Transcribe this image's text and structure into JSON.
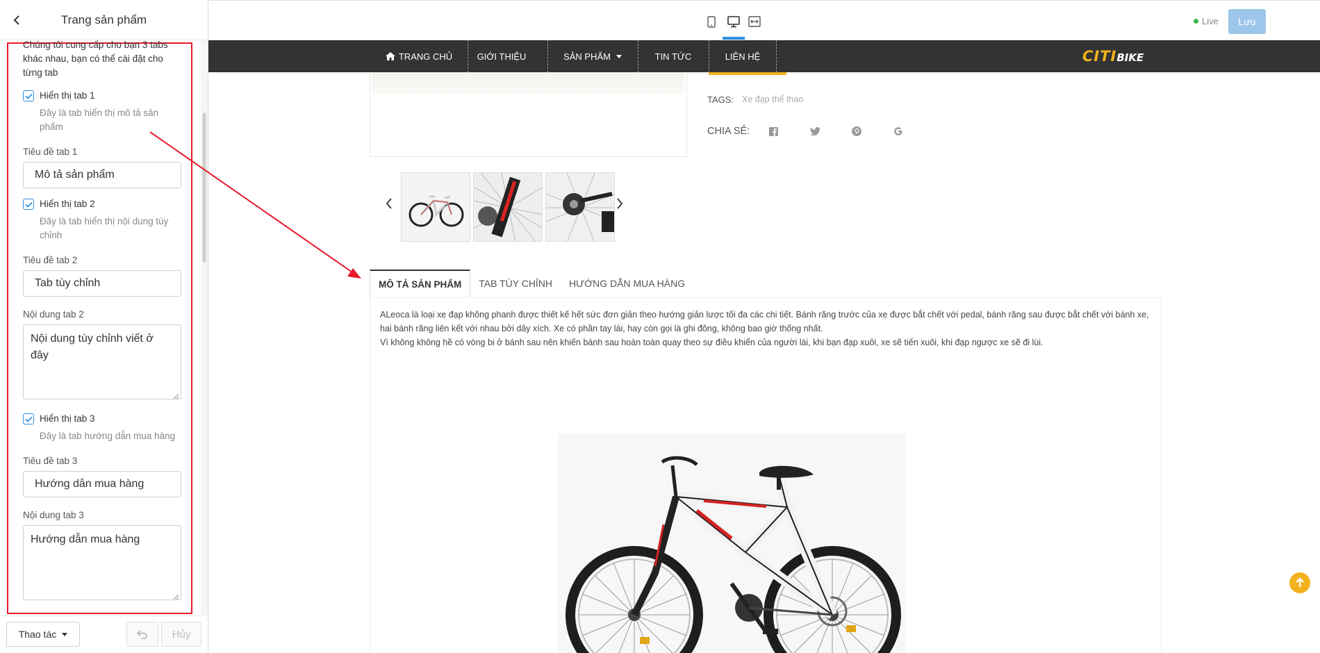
{
  "editor": {
    "panel_title": "Trang sản phẩm",
    "intro_text": "Chúng tôi cung cấp cho bạn 3 tabs khác nhau, bạn có thể cài đặt cho từng tab",
    "tab1": {
      "checkbox_label": "Hiển thị tab 1",
      "checkbox_desc": "Đây là tab hiển thị mô tả sản phẩm",
      "checked": true,
      "title_label": "Tiêu đề tab 1",
      "title_value": "Mô tả sản phẩm"
    },
    "tab2": {
      "checkbox_label": "Hiển thị tab 2",
      "checkbox_desc": "Đây là tab hiển thị nội dung tùy chỉnh",
      "checked": true,
      "title_label": "Tiêu đề tab 2",
      "title_value": "Tab tùy chỉnh",
      "content_label": "Nội dung tab 2",
      "content_value": "Nội dung tùy chỉnh viết ở đây"
    },
    "tab3": {
      "checkbox_label": "Hiển thị tab 3",
      "checkbox_desc": "Đây là tab hướng dẫn mua hàng",
      "checked": true,
      "title_label": "Tiêu đề tab 3",
      "title_value": "Hướng dẫn mua hàng",
      "content_label": "Nội dung tab 3",
      "content_value": "Hướng dẫn mua hàng"
    },
    "footer": {
      "actions_label": "Thao tác",
      "cancel_label": "Hủy"
    }
  },
  "toolbar": {
    "devices": [
      "mobile-icon",
      "desktop-icon",
      "fullwidth-icon"
    ],
    "active_device": "desktop-icon",
    "live_label": "Live",
    "save_label": "Lưu"
  },
  "site": {
    "nav": {
      "home": "TRANG CHỦ",
      "about": "GIỚI THIỆU",
      "products": "SẢN PHẨM",
      "news": "TIN TỨC",
      "contact": "LIÊN HỆ"
    },
    "logo_left": "CITI",
    "logo_right": "BIKE",
    "tags_label": "TAGS:",
    "tags_value": "Xe đạp thể thao",
    "share_label": "CHIA SẺ:",
    "share_icons": [
      "facebook-icon",
      "twitter-icon",
      "pinterest-icon",
      "google-icon"
    ],
    "tabs": [
      "MÔ TẢ SẢN PHẨM",
      "TAB TÙY CHỈNH",
      "HƯỚNG DẪN MUA HÀNG"
    ],
    "active_tab": 0,
    "description_p1": "ALeoca là loại xe đạp không phanh được thiết kế hết sức đơn giản theo hướng giản lược tối đa các chi tiết. Bánh răng trước của xe được bắt chết với pedal, bánh răng sau được bắt chết với bánh xe, hai bánh răng liên kết với nhau bởi dây xích. Xe có phần tay lái, hay còn gọi là ghi đông, không bao giờ thống nhất.",
    "description_p2": "Vì không không hề có vòng bi ở bánh sau nên khiến bánh sau hoàn toàn quay theo sự điều khiển của người lái, khi bạn đạp xuôi, xe sẽ tiến xuôi, khi đạp ngược xe sẽ đi lùi."
  },
  "colors": {
    "accent_blue": "#2f8fe0",
    "highlight_red": "#e8192c",
    "nav_bg": "#333333",
    "brand_yellow": "#f2b21d",
    "save_button": "#9dc7ea"
  }
}
